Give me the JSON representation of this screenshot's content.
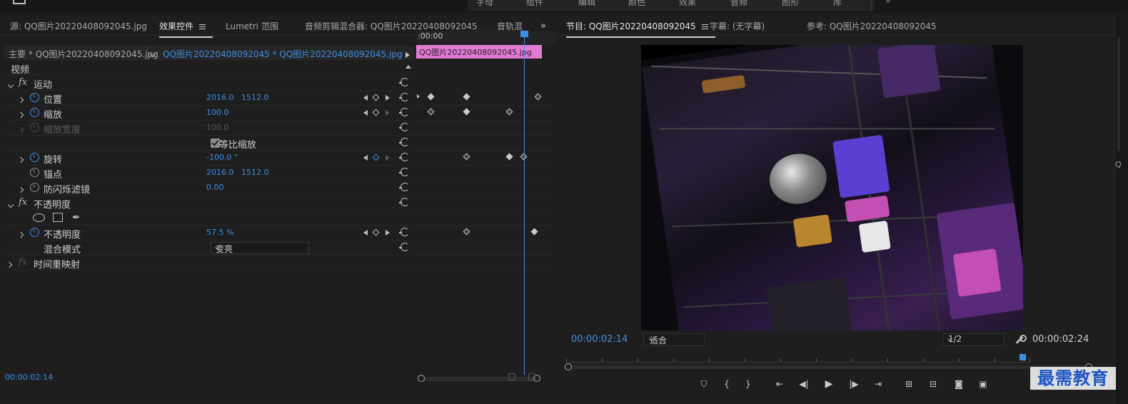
{
  "topbar": {
    "items": [
      "字母",
      "组件",
      "编辑",
      "颜色",
      "效果",
      "音频",
      "图形",
      "库"
    ]
  },
  "left_panel": {
    "tabs": {
      "source": "源: QQ图片20220408092045.jpg",
      "effects": "效果控件",
      "lumetri": "Lumetri 范围",
      "audio_mixer": "音频剪辑混合器: QQ图片20220408092045",
      "audio_track": "音轨混"
    },
    "master": "主要 * QQ图片20220408092045.jpg",
    "clip": "QQ图片20220408092045 * QQ图片20220408092045.jpg",
    "video_header": "视频",
    "rows": {
      "motion": "运动",
      "position": {
        "label": "位置",
        "x": "2016.0",
        "y": "1512.0"
      },
      "scale": {
        "label": "缩放",
        "value": "100.0"
      },
      "scale_width": {
        "label": "缩放宽度",
        "value": "100.0"
      },
      "uniform": "等比缩放",
      "rotation": {
        "label": "旋转",
        "value": "-100.0 °"
      },
      "anchor": {
        "label": "锚点",
        "x": "2016.0",
        "y": "1512.0"
      },
      "antiflicker": {
        "label": "防闪烁滤镜",
        "value": "0.00"
      },
      "opacity_group": "不透明度",
      "opacity": {
        "label": "不透明度",
        "value": "57.5 %"
      },
      "blend": {
        "label": "混合模式",
        "value": "变亮"
      },
      "time_remap": "时间重映射"
    },
    "timeline": {
      "ruler": ":00:00",
      "clip": "QQ图片20220408092045.jpg"
    },
    "current_time": "00:00:02:14"
  },
  "right_panel": {
    "tabs": {
      "program": "节目: QQ图片20220408092045",
      "captions": "字幕: (无字幕)",
      "reference": "参考: QQ图片20220408092045"
    },
    "current_time": "00:00:02:14",
    "duration": "00:00:02:24",
    "fit": "适合",
    "resolution": "1/2"
  },
  "watermark": "最需教育"
}
